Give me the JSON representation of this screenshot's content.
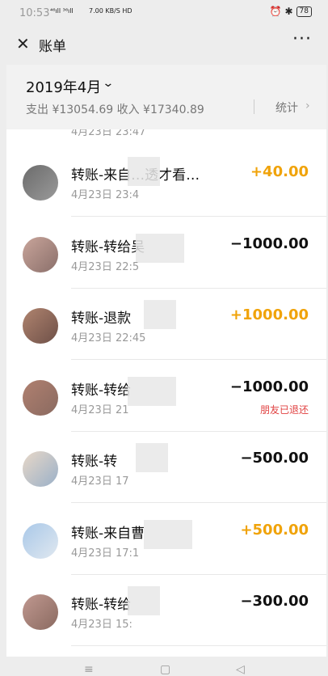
{
  "status": {
    "time": "10:53",
    "signal": "⁴⁶ıll ³⁶ıll",
    "net": "7.00 KB/S HD",
    "battery": "78"
  },
  "header": {
    "title": "账单"
  },
  "month_panel": {
    "month": "2019年4月",
    "summary": "支出 ¥13054.69 收入 ¥17340.89",
    "stats_label": "统计"
  },
  "top_partial_time": "4月23日 23:47",
  "transactions": [
    {
      "title": "转账-来自…透才看…",
      "time": "4月23日 23:4",
      "amount": "+40.00",
      "dir": "in",
      "note": ""
    },
    {
      "title": "转账-转给吴",
      "time": "4月23日 22:5",
      "amount": "−1000.00",
      "dir": "out",
      "note": ""
    },
    {
      "title": "转账-退款",
      "time": "4月23日 22:45",
      "amount": "+1000.00",
      "dir": "in",
      "note": ""
    },
    {
      "title": "转账-转给",
      "time": "4月23日 21",
      "amount": "−1000.00",
      "dir": "out",
      "note": "朋友已退还"
    },
    {
      "title": "转账-转",
      "time": "4月23日 17",
      "amount": "−500.00",
      "dir": "out",
      "note": ""
    },
    {
      "title": "转账-来自曹",
      "time": "4月23日 17:1",
      "amount": "+500.00",
      "dir": "in",
      "note": ""
    },
    {
      "title": "转账-转给",
      "time": "4月23日 15:",
      "amount": "−300.00",
      "dir": "out",
      "note": ""
    }
  ],
  "colors": {
    "income": "#f0a30a",
    "expense": "#111111",
    "refund_note": "#e04040",
    "background": "#ededed"
  }
}
